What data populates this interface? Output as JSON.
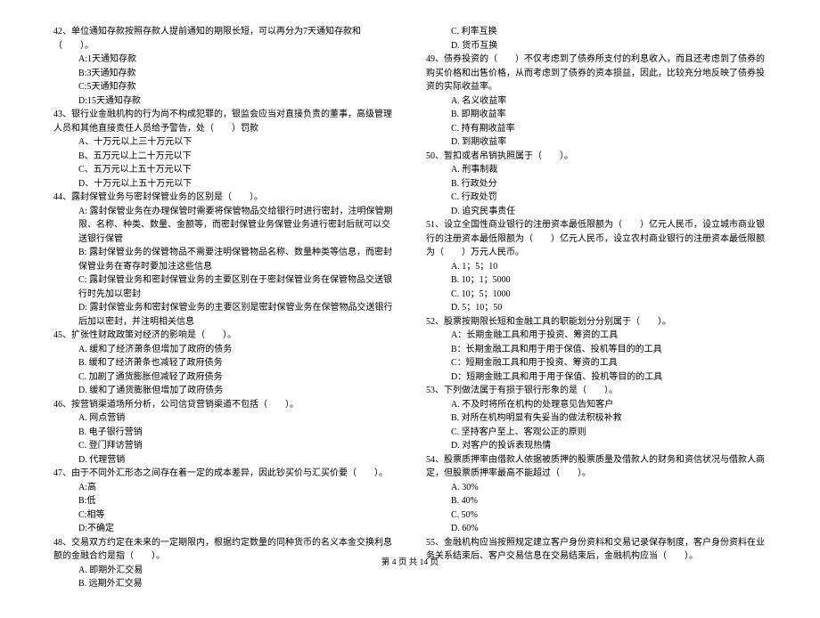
{
  "footer": "第 4 页 共 14 页",
  "left": {
    "q42": {
      "stem": "42、单位通知存款按照存款人提前通知的期限长短，可以再分为7天通知存款和（　　）。",
      "opts": [
        "A:1天通知存款",
        "B:3天通知存款",
        "C:5天通知存款",
        "D:15天通知存款"
      ]
    },
    "q43": {
      "stem": "43、银行业金融机构的行为尚不构成犯罪的，银监会应当对直接负责的董事，高级管理人员和其他直接责任人员给予警告，处（　　）罚款",
      "opts": [
        "A、十万元以上三十万元以下",
        "B、五万元以上二十万元以下",
        "C、五万元以上五十万元以下",
        "D、十万元以上五十万元以下"
      ]
    },
    "q44": {
      "stem": "44、露封保管业务与密封保管业务的区别是（　　）。",
      "opts": [
        "A: 露封保管业务在办理保管时需要将保管物品交给银行时进行密封，注明保管期限、名称、种类、数量、金额等，而密封保管业务保管业务进行密封后就可以交送银行保管",
        "B: 露封保管业务的保管物品不需要注明保管物品名称、数量种类等信息，而密封保管业务在寄存时要加注这些信息",
        "C: 露封保管业务和密封保管业务的主要区别在于密封保管业务在保管物品交送银行时先加以密封",
        "D: 露封保管业务和密封保管业务的主要区别是密封保管业务在保管物品交送银行后加以密封，并注明相关信息"
      ]
    },
    "q45": {
      "stem": "45、扩张性财政政策对经济的影响是（　　）。",
      "opts": [
        "A. 缓和了经济萧条但增加了政府的债务",
        "B. 缓和了经济萧条也减轻了政府债务",
        "C. 加剧了通货膨胀但减轻了政府债务",
        "D. 缓和了通货膨胀但增加了政府债务"
      ]
    },
    "q46": {
      "stem": "46、按营销渠道场所分析，公司信贷营销渠道不包括（　　）。",
      "opts": [
        "A. 网点营销",
        "B. 电子银行营销",
        "C. 登门拜访营销",
        "D. 代理营销"
      ]
    },
    "q47": {
      "stem": "47、由于不同外汇形态之间存在着一定的成本差异，因此钞买价与汇买价要（　　）。",
      "opts": [
        "A:高",
        "B:低",
        "C:相等",
        "D:不确定"
      ]
    },
    "q48": {
      "stem": "48、交易双方约定在未来的一定期限内，根据约定数量的同种货币的名义本金交换利息额的金融合约是指（　　）。",
      "opts": [
        "A. 即期外汇交易",
        "B. 远期外汇交易"
      ]
    }
  },
  "right": {
    "q48cont": {
      "opts": [
        "C. 利率互换",
        "D. 货币互换"
      ]
    },
    "q49": {
      "stem": "49、债券投资的（　　）不仅考虑到了债券所支付的利息收入，而且还考虑到了债券的购买价格和出售价格，从而考虑到了债券的资本损益，因此，比较充分地反映了债券投资的实际收益率。",
      "opts": [
        "A. 名义收益率",
        "B. 即期收益率",
        "C. 持有期收益率",
        "D. 到期收益率"
      ]
    },
    "q50": {
      "stem": "50、暂扣或者吊销执照属于（　　）。",
      "opts": [
        "A. 刑事制裁",
        "B. 行政处分",
        "C. 行政处罚",
        "D. 追究民事责任"
      ]
    },
    "q51": {
      "stem": "51、设立全国性商业银行的注册资本最低限额为（　　）亿元人民币，设立城市商业银行的注册资本最低限额为（　　）亿元人民币，设立农村商业银行的注册资本最低限额为（　　）万元人民币。",
      "opts": [
        "A. 1；5；10",
        "B. 10；1；5000",
        "C. 10；5；1000",
        "D. 5；10；50"
      ]
    },
    "q52": {
      "stem": "52、股票按期限长短和金融工具的职能划分分别属于（　　）。",
      "opts": [
        "A：长期金融工具和用于投资、筹资的工具",
        "B：长期金融工具和用于用于保值、投机等目的的工具",
        "C：短期金融工具和用于投资、筹资的工具",
        "D：短期金融工具和用于用于保值、投机等目的的工具"
      ]
    },
    "q53": {
      "stem": "53、下列做法属于有损于银行形象的是（　　）。",
      "opts": [
        "A. 不及时将所在机构的处理意见告知客户",
        "B. 对所在机构明显有失妥当的做法积极补救",
        "C. 坚持客户至上、客观公正的原则",
        "D. 对客户的投诉表现热情"
      ]
    },
    "q54": {
      "stem": "54、股票质押率由借款人依据被质押的股票质量及借款人的财务和资信状况与借款人商定，但股票质押率最高不能超过（　　）。",
      "opts": [
        "A. 30%",
        "B. 40%",
        "C. 50%",
        "D. 60%"
      ]
    },
    "q55": {
      "stem": "55、金融机构应当按照规定建立客户身份资料和交易记录保存制度，客户身份资料在业务关系结束后、客户交易信息在交易结束后，金融机构应当（　　）。"
    }
  }
}
